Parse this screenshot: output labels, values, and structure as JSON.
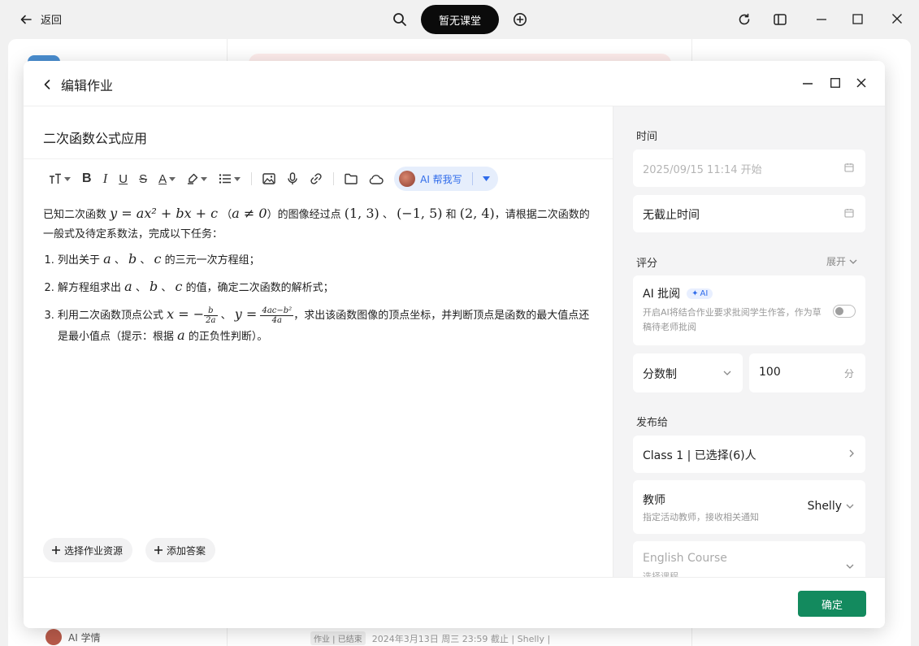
{
  "topbar": {
    "back_label": "返回",
    "pill_label": "暂无课堂"
  },
  "background": {
    "bottom_left_label": "AI 学情",
    "bottom_status_tag": "作业 | 已结束",
    "bottom_status_text": "2024年3月13日 周三 23:59 截止 | Shelly |"
  },
  "modal": {
    "title": "编辑作业",
    "homework_title": "二次函数公式应用",
    "toolbar": {
      "ai_label": "AI 帮我写"
    },
    "content": {
      "intro_1": "已知二次函数",
      "eq_main": "y = ax² + bx + c",
      "cond_open": "（",
      "cond": "a ≠ 0",
      "cond_close": "）的图像经过点",
      "pt1": "(1, 3)",
      "sep1": "、",
      "pt2": "(−1, 5)",
      "and": "和",
      "pt3": "(2, 4)",
      "intro_2": "，请根据二次函数的一般式及待定系数法，完成以下任务：",
      "item1_pre": "列出关于",
      "item1_post": "的三元一次方程组；",
      "item2_pre": "解方程组求出",
      "item2_post": "的值，确定二次函数的解析式；",
      "item3_pre": "利用二次函数顶点公式",
      "item3_x": "x = −",
      "item3_b": "b",
      "item3_2a": "2a",
      "item3_sep": "、",
      "item3_y": "y =",
      "item3_num": "4ac−b²",
      "item3_den": "4a",
      "item3_post": "，求出该函数图像的顶点坐标，并判断顶点是函数的最大值点还是最小值点（提示：根据",
      "item3_a": "a",
      "item3_tail": "的正负性判断）。",
      "var_a": "a",
      "var_b": "b",
      "var_c": "c",
      "comma": "、"
    },
    "buttons": {
      "select_resource": "选择作业资源",
      "add_answer": "添加答案",
      "confirm": "确定"
    },
    "panel": {
      "time_label": "时间",
      "start_time": "2025/09/15 11:14 开始",
      "deadline": "无截止时间",
      "grading_label": "评分",
      "expand": "展开",
      "ai_review_title": "AI 批阅",
      "ai_badge": "AI",
      "ai_review_desc": "开启AI将结合作业要求批阅学生作答，作为草稿待老师批阅",
      "ai_review_enabled": false,
      "score_mode": "分数制",
      "score_value": "100",
      "score_unit": "分",
      "publish_label": "发布给",
      "class_select": "Class 1 | 已选择(6)人",
      "teacher_label": "教师",
      "teacher_desc": "指定活动教师，接收相关通知",
      "teacher_value": "Shelly",
      "course_placeholder": "English Course",
      "course_sub": "选择课程"
    }
  },
  "colors": {
    "primary_green": "#138a5e",
    "ai_blue": "#2f6bea",
    "panel_bg": "#f4f4f5"
  }
}
